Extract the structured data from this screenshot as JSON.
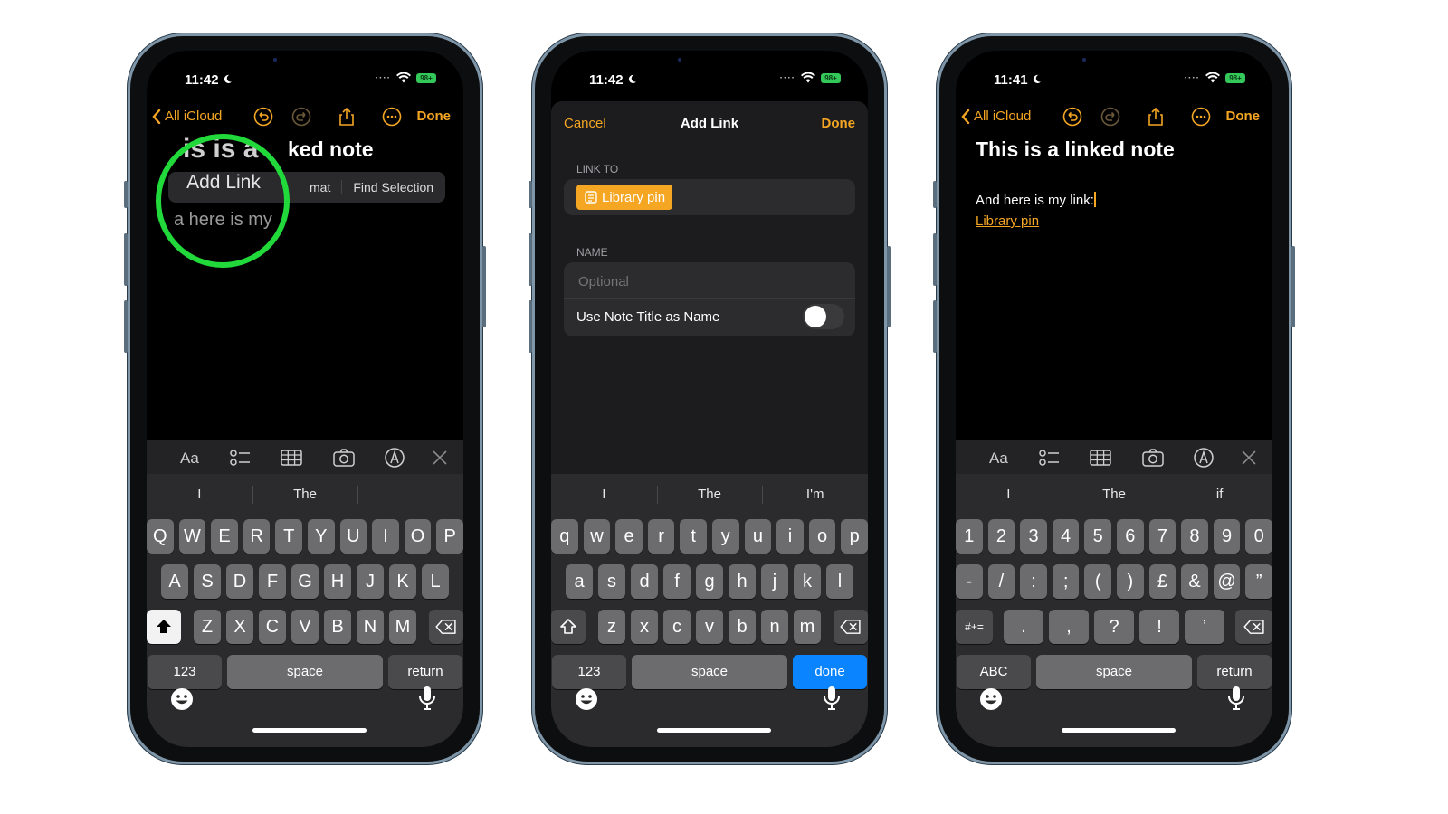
{
  "colors": {
    "accent": "#f5a623",
    "done_key": "#0a84ff",
    "highlight_ring": "#21d93a",
    "battery": "#34c759"
  },
  "phones": [
    {
      "status": {
        "time": "11:42",
        "battery": "98+"
      },
      "nav": {
        "back": "All iCloud",
        "done": "Done"
      },
      "note": {
        "title_visible": "ked note",
        "title_fragment": "is is a",
        "body_fragment": "a here is my"
      },
      "callout": {
        "add_link": "Add Link",
        "format": "mat",
        "find": "Find Selection"
      },
      "predictions": [
        "I",
        "The",
        ""
      ],
      "keys": {
        "row1": [
          "Q",
          "W",
          "E",
          "R",
          "T",
          "Y",
          "U",
          "I",
          "O",
          "P"
        ],
        "row2": [
          "A",
          "S",
          "D",
          "F",
          "G",
          "H",
          "J",
          "K",
          "L"
        ],
        "row3": [
          "Z",
          "X",
          "C",
          "V",
          "B",
          "N",
          "M"
        ],
        "num": "123",
        "space": "space",
        "action": "return"
      }
    },
    {
      "status": {
        "time": "11:42",
        "battery": "98+"
      },
      "sheet": {
        "cancel": "Cancel",
        "title": "Add Link",
        "done": "Done",
        "link_to_label": "LINK TO",
        "link_chip": "Library pin",
        "name_label": "NAME",
        "name_placeholder": "Optional",
        "use_title": "Use Note Title as Name",
        "use_title_on": false
      },
      "predictions": [
        "I",
        "The",
        "I'm"
      ],
      "keys": {
        "row1": [
          "q",
          "w",
          "e",
          "r",
          "t",
          "y",
          "u",
          "i",
          "o",
          "p"
        ],
        "row2": [
          "a",
          "s",
          "d",
          "f",
          "g",
          "h",
          "j",
          "k",
          "l"
        ],
        "row3": [
          "z",
          "x",
          "c",
          "v",
          "b",
          "n",
          "m"
        ],
        "num": "123",
        "space": "space",
        "action": "done"
      }
    },
    {
      "status": {
        "time": "11:41",
        "battery": "98+"
      },
      "nav": {
        "back": "All iCloud",
        "done": "Done"
      },
      "note": {
        "title": "This is a linked note",
        "body": "And here is my link:",
        "link": "Library pin"
      },
      "predictions": [
        "I",
        "The",
        "if"
      ],
      "keys": {
        "row1": [
          "1",
          "2",
          "3",
          "4",
          "5",
          "6",
          "7",
          "8",
          "9",
          "0"
        ],
        "row2": [
          "-",
          "/",
          ":",
          ";",
          "(",
          ")",
          "£",
          "&",
          "@",
          "”"
        ],
        "row3": [
          ".",
          ",",
          "?",
          "!",
          "’"
        ],
        "sym": "#+=",
        "abc": "ABC",
        "space": "space",
        "action": "return"
      }
    }
  ]
}
